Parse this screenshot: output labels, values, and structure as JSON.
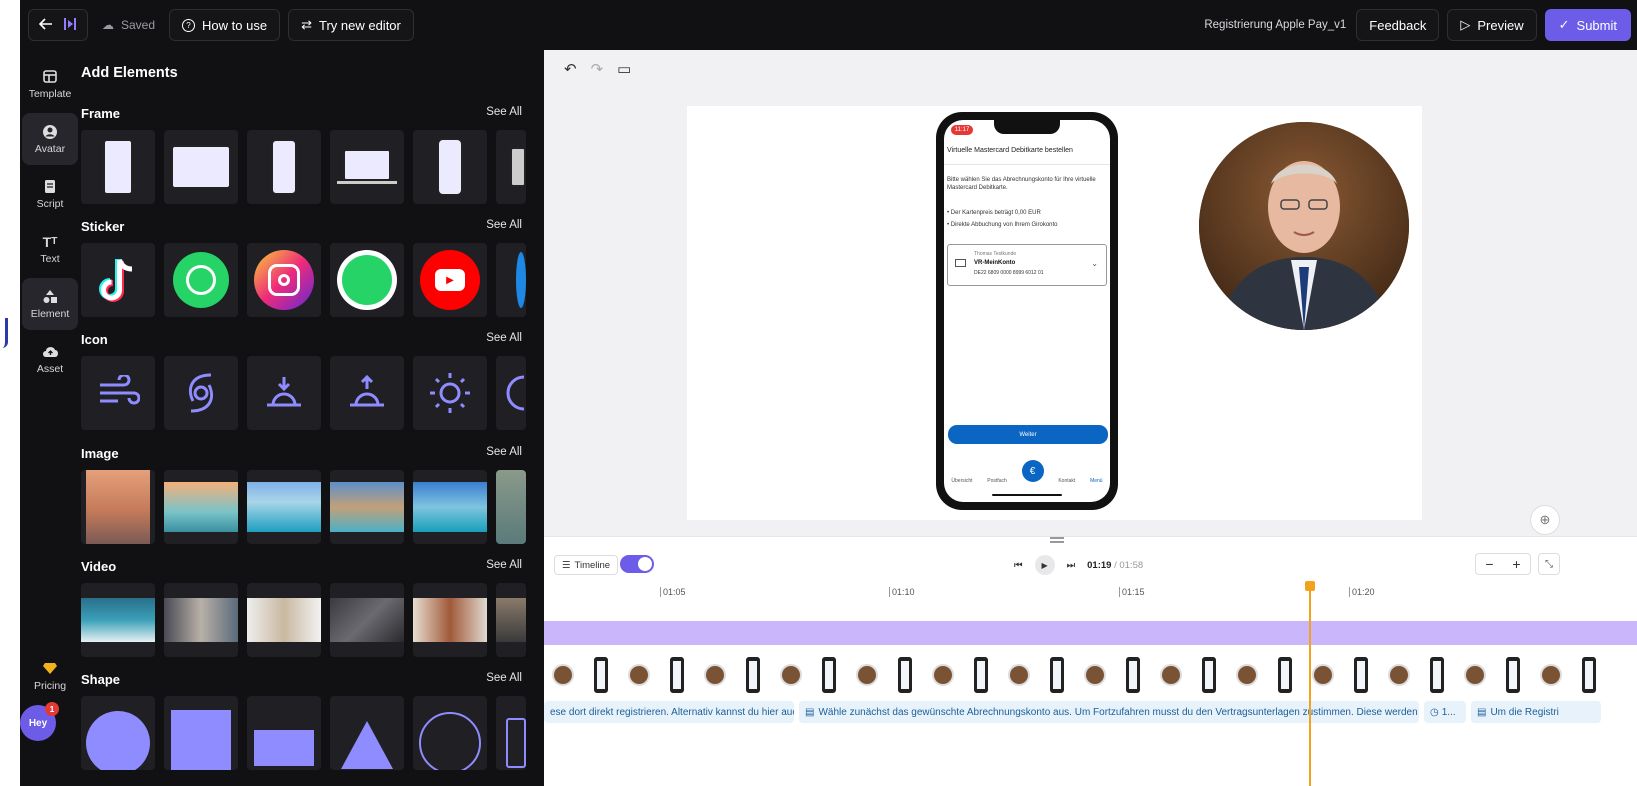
{
  "topbar": {
    "back_icon": "arrow-left-icon",
    "saved": "Saved",
    "how_to_use": "How to use",
    "try_editor": "Try new editor",
    "project_title": "Registrierung Apple Pay_v1",
    "feedback": "Feedback",
    "preview": "Preview",
    "submit": "Submit"
  },
  "rail": {
    "items": [
      {
        "label": "Template",
        "icon": "template-icon"
      },
      {
        "label": "Avatar",
        "icon": "avatar-icon"
      },
      {
        "label": "Script",
        "icon": "script-icon"
      },
      {
        "label": "Text",
        "icon": "text-icon"
      },
      {
        "label": "Element",
        "icon": "element-icon"
      },
      {
        "label": "Asset",
        "icon": "upload-icon"
      }
    ],
    "pricing": "Pricing",
    "user_initials": "Hey",
    "notification_count": "1"
  },
  "panel": {
    "title": "Add Elements",
    "see_all": "See All",
    "sections": [
      "Frame",
      "Sticker",
      "Icon",
      "Image",
      "Video",
      "Shape"
    ]
  },
  "phone": {
    "status_time": "11:17",
    "header": "Virtuelle Mastercard Debitkarte bestellen",
    "intro": "Bitte wählen Sie das Abrechnungskonto für Ihre virtuelle Mastercard Debitkarte.",
    "bullet1": "• Der Kartenpreis beträgt 0,00 EUR",
    "bullet2": "• Direkte Abbuchung von Ihrem Girokonto",
    "account_owner": "Thomas Testkunde",
    "account_name": "VR-MeinKonto",
    "iban": "DE22 6809 0000 8999 6012 01",
    "button": "Weiter",
    "nav": [
      "Übersicht",
      "Postfach",
      "",
      "Kontakt",
      "Menü"
    ]
  },
  "timeline": {
    "label": "Timeline",
    "current_time": "01:19",
    "total_time": "01:58",
    "ruler_labels": [
      "01:05",
      "01:10",
      "01:15",
      "01:20"
    ],
    "captions": [
      "ese dort direkt registrieren. Alternativ kannst du hier auc...",
      "Wähle zunächst das gewünschte Abrechnungskonto aus. Um Fortzufahren musst du den Vertragsunterlagen zustimmen. Diese werden i...",
      "1...",
      "Um die Registri"
    ]
  }
}
